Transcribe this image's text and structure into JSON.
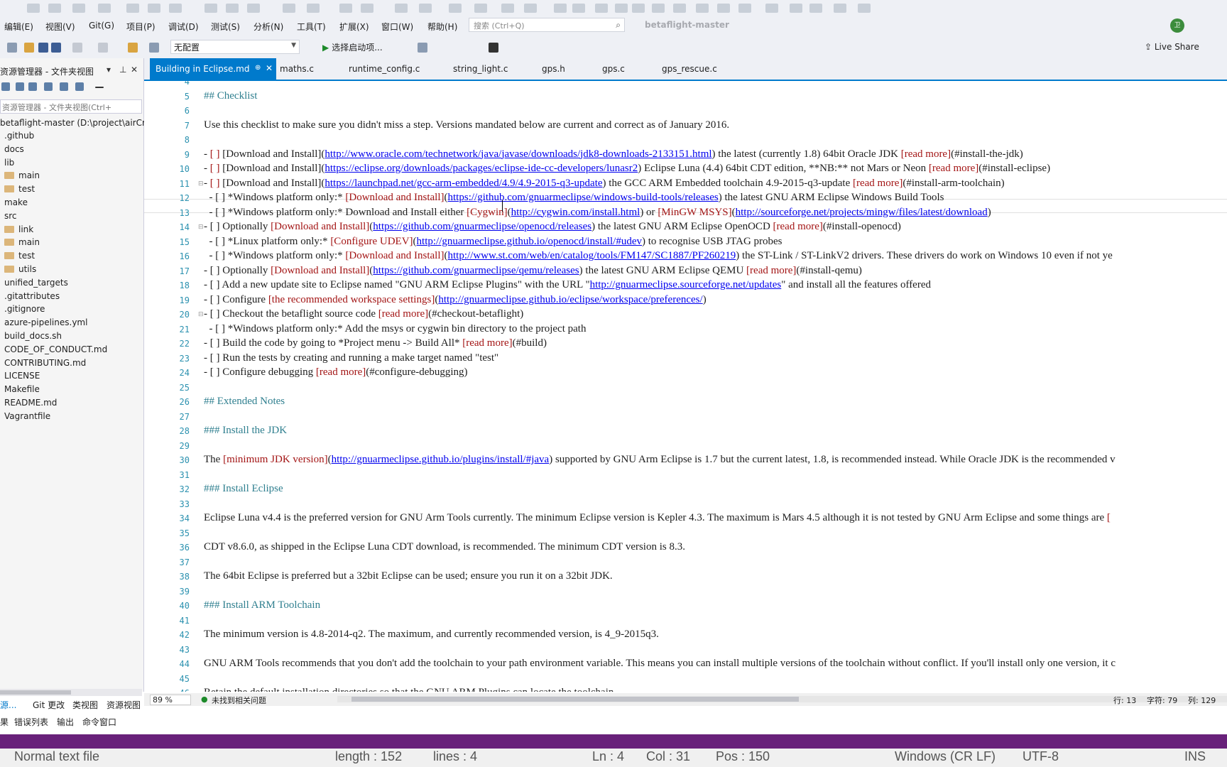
{
  "menu": [
    "编辑(E)",
    "视图(V)",
    "Git(G)",
    "项目(P)",
    "调试(D)",
    "测试(S)",
    "分析(N)",
    "工具(T)",
    "扩展(X)",
    "窗口(W)",
    "帮助(H)"
  ],
  "search": {
    "placeholder": "搜索 (Ctrl+Q)"
  },
  "solution_name": "betaflight-master",
  "avatar_initials": "卫",
  "toolbar": {
    "config_value": "无配置",
    "start_label": "选择启动项...",
    "live_share": "Live Share"
  },
  "explorer": {
    "title": "资源管理器 - 文件夹视图",
    "search_placeholder": "资源管理器 - 文件夹视图(Ctrl+",
    "root": "betaflight-master (D:\\project\\airCraft",
    "items": [
      {
        "label": ".github",
        "folder": false
      },
      {
        "label": "docs",
        "folder": false
      },
      {
        "label": "lib",
        "folder": false
      },
      {
        "label": "main",
        "folder": true
      },
      {
        "label": "test",
        "folder": true
      },
      {
        "label": "make",
        "folder": false
      },
      {
        "label": "src",
        "folder": false
      },
      {
        "label": "link",
        "folder": true
      },
      {
        "label": "main",
        "folder": true
      },
      {
        "label": "test",
        "folder": true
      },
      {
        "label": "utils",
        "folder": true
      },
      {
        "label": "unified_targets",
        "folder": false
      },
      {
        "label": ".gitattributes",
        "folder": false
      },
      {
        "label": ".gitignore",
        "folder": false
      },
      {
        "label": "azure-pipelines.yml",
        "folder": false
      },
      {
        "label": "build_docs.sh",
        "folder": false
      },
      {
        "label": "CODE_OF_CONDUCT.md",
        "folder": false
      },
      {
        "label": "CONTRIBUTING.md",
        "folder": false
      },
      {
        "label": "LICENSE",
        "folder": false
      },
      {
        "label": "Makefile",
        "folder": false
      },
      {
        "label": "README.md",
        "folder": false
      },
      {
        "label": "Vagrantfile",
        "folder": false
      }
    ],
    "bottom_tabs": [
      "源...",
      "Git 更改",
      "类视图",
      "资源视图"
    ],
    "output_tabs": [
      "果",
      "错误列表",
      "输出",
      "命令窗口"
    ]
  },
  "tabs": [
    "Building in Eclipse.md",
    "maths.c",
    "runtime_config.c",
    "string_light.c",
    "gps.h",
    "gps.c",
    "gps_rescue.c"
  ],
  "editor_lines": [
    {
      "n": "4",
      "html": ""
    },
    {
      "n": "5",
      "html": "<span class='h'>## Checklist</span>"
    },
    {
      "n": "6",
      "html": ""
    },
    {
      "n": "7",
      "html": "Use this checklist to make sure you didn't miss a step. Versions mandated below are current and correct as of January 2016."
    },
    {
      "n": "8",
      "html": ""
    },
    {
      "n": "9",
      "html": "- <span class='r'>[ ]</span> [Download and Install](<span class='u'>http://www.oracle.com/technetwork/java/javase/downloads/jdk8-downloads-2133151.html</span>) the latest (currently 1.8) 64bit Oracle JDK <span class='r'>[read more]</span>(#install-the-jdk)"
    },
    {
      "n": "10",
      "html": "- <span class='r'>[ ]</span> [Download and Install](<span class='u'>https://eclipse.org/downloads/packages/eclipse-ide-cc-developers/lunasr2</span>) Eclipse Luna (4.4) 64bit CDT edition, **NB:** not Mars or Neon <span class='r'>[read more]</span>(#install-eclipse)"
    },
    {
      "n": "11",
      "html": "- <span class='r'>[ ]</span> [Download and Install](<span class='u'>https://launchpad.net/gcc-arm-embedded/4.9/4.9-2015-q3-update</span>) the GCC ARM Embedded toolchain 4.9-2015-q3-update <span class='r'>[read more]</span>(#install-arm-toolchain)"
    },
    {
      "n": "12",
      "html": "&nbsp;&nbsp;- [ ] *Windows platform only:* <span class='r'>[Download and Install]</span>(<span class='u'>https://github.com/gnuarmeclipse/windows-build-tools/releases</span>) the latest GNU ARM Eclipse Windows Build Tools"
    },
    {
      "n": "13",
      "html": "&nbsp;&nbsp;- [ ] *Windows platform only:* Download and Install either <span class='r'>[Cygwin]</span>(<span class='u'>http://cygwin.com/install.html</span>) or <span class='r'>[MinGW MSYS]</span>(<span class='u'>http://sourceforge.net/projects/mingw/files/latest/download</span>)"
    },
    {
      "n": "14",
      "html": "- [ ] Optionally <span class='r'>[Download and Install]</span>(<span class='u'>https://github.com/gnuarmeclipse/openocd/releases</span>) the latest GNU ARM Eclipse OpenOCD <span class='r'>[read more]</span>(#install-openocd)"
    },
    {
      "n": "15",
      "html": "&nbsp;&nbsp;- [ ] *Linux platform only:* <span class='r'>[Configure UDEV]</span>(<span class='u'>http://gnuarmeclipse.github.io/openocd/install/#udev</span>) to recognise USB JTAG probes"
    },
    {
      "n": "16",
      "html": "&nbsp;&nbsp;- [ ] *Windows platform only:* <span class='r'>[Download and Install]</span>(<span class='u'>http://www.st.com/web/en/catalog/tools/FM147/SC1887/PF260219</span>) the ST-Link / ST-LinkV2 drivers. These drivers do work on Windows 10 even if not ye"
    },
    {
      "n": "17",
      "html": "- [ ] Optionally <span class='r'>[Download and Install]</span>(<span class='u'>https://github.com/gnuarmeclipse/qemu/releases</span>) the latest GNU ARM Eclipse QEMU <span class='r'>[read more]</span>(#install-qemu)"
    },
    {
      "n": "18",
      "html": "- [ ] Add a new update site to Eclipse named \"GNU ARM Eclipse Plugins\" with the URL \"<span class='u'>http://gnuarmeclipse.sourceforge.net/updates</span>\" and install all the features offered"
    },
    {
      "n": "19",
      "html": "- [ ] Configure <span class='r'>[the recommended workspace settings]</span>(<span class='u'>http://gnuarmeclipse.github.io/eclipse/workspace/preferences/</span>)"
    },
    {
      "n": "20",
      "html": "- [ ] Checkout the betaflight source code <span class='r'>[read more]</span>(#checkout-betaflight)"
    },
    {
      "n": "21",
      "html": "&nbsp;&nbsp;- [ ] *Windows platform only:* Add the msys or cygwin bin directory to the project path"
    },
    {
      "n": "22",
      "html": "- [ ] Build the code by going to *Project menu -&gt; Build All* <span class='r'>[read more]</span>(#build)"
    },
    {
      "n": "23",
      "html": "- [ ] Run the tests by creating and running a make target named \"test\""
    },
    {
      "n": "24",
      "html": "- [ ] Configure debugging <span class='r'>[read more]</span>(#configure-debugging)"
    },
    {
      "n": "25",
      "html": ""
    },
    {
      "n": "26",
      "html": "<span class='h'>## Extended Notes</span>"
    },
    {
      "n": "27",
      "html": ""
    },
    {
      "n": "28",
      "html": "<span class='h'>### Install the JDK</span>"
    },
    {
      "n": "29",
      "html": ""
    },
    {
      "n": "30",
      "html": "The <span class='r'>[minimum JDK version]</span>(<span class='u'>http://gnuarmeclipse.github.io/plugins/install/#java</span>) supported by GNU Arm Eclipse is 1.7 but the current latest, 1.8, is recommended instead. While Oracle JDK is the recommended v"
    },
    {
      "n": "31",
      "html": ""
    },
    {
      "n": "32",
      "html": "<span class='h'>### Install Eclipse</span>"
    },
    {
      "n": "33",
      "html": ""
    },
    {
      "n": "34",
      "html": "Eclipse Luna v4.4 is the preferred version for GNU Arm Tools currently. The minimum Eclipse version is Kepler 4.3. The maximum is Mars 4.5 although it is not tested by GNU Arm Eclipse and some things are <span class='r'>[</span>"
    },
    {
      "n": "35",
      "html": ""
    },
    {
      "n": "36",
      "html": "CDT v8.6.0, as shipped in the Eclipse Luna CDT download, is recommended. The minimum CDT version is 8.3."
    },
    {
      "n": "37",
      "html": ""
    },
    {
      "n": "38",
      "html": "The 64bit Eclipse is preferred but a 32bit Eclipse can be used; ensure you run it on a 32bit JDK."
    },
    {
      "n": "39",
      "html": ""
    },
    {
      "n": "40",
      "html": "<span class='h'>### Install ARM Toolchain</span>"
    },
    {
      "n": "41",
      "html": ""
    },
    {
      "n": "42",
      "html": "The minimum version is 4.8-2014-q2. The maximum, and currently recommended version, is 4_9-2015q3."
    },
    {
      "n": "43",
      "html": ""
    },
    {
      "n": "44",
      "html": "GNU ARM Tools recommends that you don't add the toolchain to your path environment variable. This means you can install multiple versions of the toolchain without conflict. If you'll install only one version, it c"
    },
    {
      "n": "45",
      "html": ""
    },
    {
      "n": "46",
      "html": "Retain the default installation directories so that the GNU ARM Plugins can locate the toolchain."
    }
  ],
  "status": {
    "zoom": "89 %",
    "issues": "未找到相关问题",
    "row": "行: 13",
    "char": "字符: 79",
    "col": "列: 129"
  },
  "npp_status": {
    "type": "Normal text file",
    "length": "length : 152",
    "lines": "lines : 4",
    "ln": "Ln : 4",
    "col": "Col : 31",
    "pos": "Pos : 150",
    "eol": "Windows (CR LF)",
    "enc": "UTF-8",
    "ins": "INS"
  }
}
